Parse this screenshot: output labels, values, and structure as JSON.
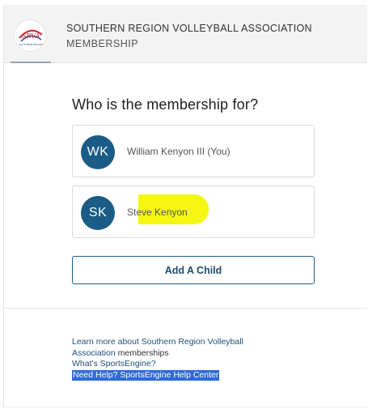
{
  "header": {
    "org_name": "SOUTHERN REGION VOLLEYBALL ASSOCIATION",
    "page": "MEMBERSHIP",
    "logo_text": "SRVA",
    "logo_subtext": "SOUTHERN REGION"
  },
  "main": {
    "question": "Who is the membership for?",
    "members": [
      {
        "initials": "WK",
        "name": "William Kenyon III (You)"
      },
      {
        "initials": "SK",
        "name": "Steve Kenyon"
      }
    ],
    "add_child_label": "Add A Child"
  },
  "footer": {
    "learn_more_link": "Learn more about Southern Region Volleyball Association",
    "learn_more_suffix": "memberships",
    "whats_link": "What's SportsEngine?",
    "help_prefix": "Need Help?",
    "help_link": "SportsEngine Help Center"
  },
  "colors": {
    "avatar": "#1a5c85",
    "button_border": "#1d5f88",
    "highlight": "#f6f710",
    "selection": "#2e6ad8"
  }
}
